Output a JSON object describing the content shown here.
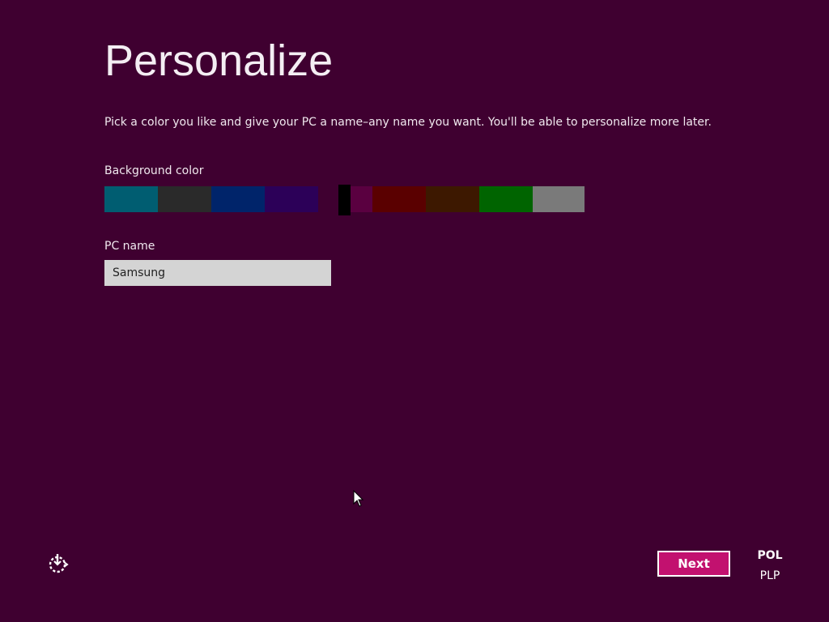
{
  "header": {
    "title": "Personalize",
    "description": "Pick a color you like and give your PC a name–any name you want. You'll be able to personalize more later."
  },
  "background_color": {
    "label": "Background color",
    "swatches": [
      {
        "name": "teal",
        "color": "#005d71"
      },
      {
        "name": "dark-gray",
        "color": "#2a2a2a"
      },
      {
        "name": "navy",
        "color": "#00246a"
      },
      {
        "name": "indigo",
        "color": "#2c0058"
      },
      {
        "name": "plum-left",
        "color": "#3f0030"
      },
      {
        "name": "plum-right",
        "color": "#5a0040"
      },
      {
        "name": "dark-red",
        "color": "#5a0000"
      },
      {
        "name": "brown",
        "color": "#3d1800"
      },
      {
        "name": "green",
        "color": "#006400"
      },
      {
        "name": "gray",
        "color": "#7a7a7a"
      }
    ],
    "selected": "plum",
    "thumb_color": "#000000"
  },
  "pc_name": {
    "label": "PC name",
    "value": "Samsung",
    "placeholder": ""
  },
  "footer": {
    "ease_of_access_icon": "ease-of-access-icon",
    "next_label": "Next",
    "language_code": "POL",
    "keyboard_layout": "PLP"
  },
  "colors": {
    "background": "#3f0030",
    "accent": "#c2116f"
  }
}
